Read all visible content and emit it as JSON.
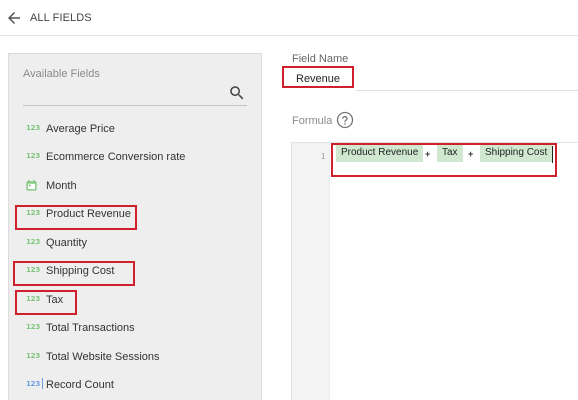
{
  "header": {
    "title": "ALL FIELDS"
  },
  "sidebar": {
    "label": "Available Fields",
    "search_placeholder": "",
    "items": [
      {
        "icon": "123",
        "label": "Average Price"
      },
      {
        "icon": "123",
        "label": "Ecommerce Conversion rate"
      },
      {
        "icon": "calendar",
        "label": "Month"
      },
      {
        "icon": "123",
        "label": "Product Revenue"
      },
      {
        "icon": "123",
        "label": "Quantity"
      },
      {
        "icon": "123",
        "label": "Shipping Cost"
      },
      {
        "icon": "123",
        "label": "Tax"
      },
      {
        "icon": "123",
        "label": "Total Transactions"
      },
      {
        "icon": "123",
        "label": "Total Website Sessions"
      },
      {
        "icon": "123",
        "label": "Record Count"
      }
    ]
  },
  "editor": {
    "field_name_label": "Field Name",
    "field_name_value": "Revenue",
    "formula_label": "Formula",
    "line_number": "1",
    "tokens": [
      {
        "type": "field",
        "text": "Product Revenue"
      },
      {
        "type": "operator",
        "text": "+"
      },
      {
        "type": "field",
        "text": "Tax"
      },
      {
        "type": "operator",
        "text": "+"
      },
      {
        "type": "field",
        "text": "Shipping Cost"
      }
    ]
  },
  "colors": {
    "highlight": "#d0202b",
    "chip": "#cfe8cf",
    "number_icon": "#7cc67c",
    "record_icon": "#6c9ee8"
  }
}
